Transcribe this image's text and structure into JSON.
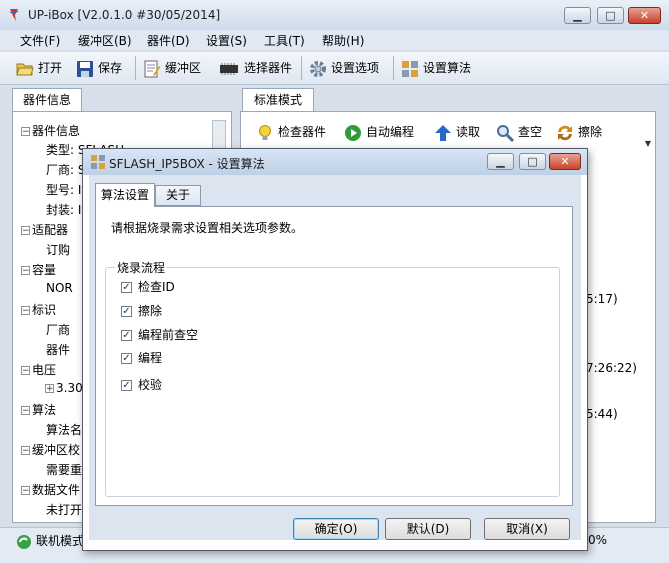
{
  "window": {
    "title": "UP-iBox  [V2.0.1.0 #30/05/2014]",
    "min_glyph": "▁",
    "max_glyph": "□",
    "close_glyph": "✕"
  },
  "menu": [
    "文件(F)",
    "缓冲区(B)",
    "器件(D)",
    "设置(S)",
    "工具(T)",
    "帮助(H)"
  ],
  "toolbar": {
    "open": "打开",
    "save": "保存",
    "buffer": "缓冲区",
    "select_device": "选择器件",
    "settings_options": "设置选项",
    "settings_algo": "设置算法"
  },
  "left_panel": {
    "tab": "器件信息",
    "tree": [
      {
        "kind": "group",
        "text": "器件信息"
      },
      {
        "kind": "child",
        "text": "类型: SFLASH"
      },
      {
        "kind": "child",
        "text": "厂商: S"
      },
      {
        "kind": "child",
        "text": "型号: I"
      },
      {
        "kind": "child",
        "text": "封装: I"
      },
      {
        "kind": "group",
        "text": "适配器"
      },
      {
        "kind": "child",
        "text": "订购"
      },
      {
        "kind": "group",
        "text": "容量"
      },
      {
        "kind": "child",
        "text": "NOR"
      },
      {
        "kind": "group",
        "text": "标识"
      },
      {
        "kind": "child",
        "text": "厂商"
      },
      {
        "kind": "child",
        "text": "器件"
      },
      {
        "kind": "group",
        "text": "电压"
      },
      {
        "kind": "plus",
        "text": "3.30"
      },
      {
        "kind": "group",
        "text": "算法"
      },
      {
        "kind": "child",
        "text": "算法名"
      },
      {
        "kind": "group",
        "text": "缓冲区校"
      },
      {
        "kind": "child",
        "text": "需要重"
      },
      {
        "kind": "group",
        "text": "数据文件"
      },
      {
        "kind": "child",
        "text": "未打开"
      }
    ]
  },
  "right_panel": {
    "tab": "标准模式",
    "buttons": {
      "check": "检查器件",
      "auto": "自动编程",
      "read": "读取",
      "blank": "查空",
      "erase": "擦除"
    },
    "log_fragments": [
      "5:17)",
      "7:26:22)",
      "5:44)"
    ]
  },
  "status": {
    "online": "联机模式",
    "percent": "0%"
  },
  "dialog": {
    "title": "SFLASH_IP5BOX - 设置算法",
    "tab_algo": "算法设置",
    "tab_about": "关于",
    "description": "请根据烧录需求设置相关选项参数。",
    "group_title": "烧录流程",
    "options": [
      {
        "label": "检查ID",
        "checked": true
      },
      {
        "label": "擦除",
        "checked": true
      },
      {
        "label": "编程前查空",
        "checked": true
      },
      {
        "label": "编程",
        "checked": true
      },
      {
        "label": "校验",
        "checked": true
      }
    ],
    "ok": "确定(O)",
    "default": "默认(D)",
    "cancel": "取消(X)",
    "check_glyph": "✓"
  }
}
